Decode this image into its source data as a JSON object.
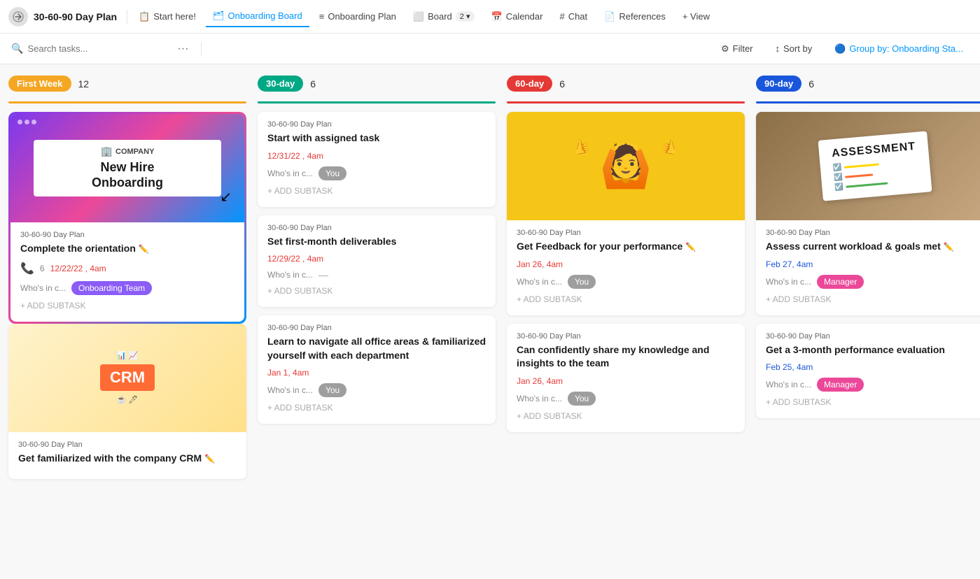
{
  "header": {
    "logo_text": "☰",
    "title": "30-60-90 Day Plan",
    "nav_items": [
      {
        "label": "Start here!",
        "icon": "📋",
        "active": false
      },
      {
        "label": "Onboarding Board",
        "icon": "🗂",
        "active": true
      },
      {
        "label": "Onboarding Plan",
        "icon": "≡",
        "active": false
      },
      {
        "label": "Board",
        "icon": "⬜",
        "active": false,
        "badge": "2"
      },
      {
        "label": "Calendar",
        "icon": "📅",
        "active": false
      },
      {
        "label": "Chat",
        "icon": "#",
        "active": false
      },
      {
        "label": "References",
        "icon": "📄",
        "active": false
      },
      {
        "label": "+ View",
        "icon": "",
        "active": false
      }
    ]
  },
  "toolbar": {
    "search_placeholder": "Search tasks...",
    "filter_label": "Filter",
    "sort_label": "Sort by",
    "group_by_label": "Group by: Onboarding Sta..."
  },
  "columns": [
    {
      "id": "first-week",
      "tag": "First Week",
      "tag_class": "tag-first",
      "line_class": "line-first",
      "count": 12,
      "cards": [
        {
          "type": "onboarding-image",
          "project": "30-60-90 Day Plan",
          "title": "Complete the orientation",
          "has_edit": true,
          "date": "12/22/22 , 4am",
          "date_class": "card-date-red",
          "subtask_count": "6",
          "who": "Onboarding Team",
          "who_badge": "badge-team",
          "add_subtask": "+ ADD SUBTASK"
        },
        {
          "type": "crm-image",
          "project": "30-60-90 Day Plan",
          "title": "Get familiarized with the company CRM",
          "has_edit": true
        }
      ]
    },
    {
      "id": "30-day",
      "tag": "30-day",
      "tag_class": "tag-30",
      "line_class": "line-30",
      "count": 6,
      "cards": [
        {
          "type": "no-image",
          "project": "30-60-90 Day Plan",
          "title": "Start with assigned task",
          "has_edit": false,
          "date": "12/31/22 , 4am",
          "date_class": "card-date-red",
          "who": "You",
          "who_badge": "badge-you",
          "add_subtask": "+ ADD SUBTASK"
        },
        {
          "type": "no-image",
          "project": "30-60-90 Day Plan",
          "title": "Set first-month deliverables",
          "has_edit": false,
          "date": "12/29/22 , 4am",
          "date_class": "card-date-red",
          "who": "—",
          "who_badge": "",
          "add_subtask": "+ ADD SUBTASK"
        },
        {
          "type": "no-image",
          "project": "30-60-90 Day Plan",
          "title": "Learn to navigate all office areas & familiarized yourself with each department",
          "has_edit": false,
          "date": "Jan 1, 4am",
          "date_class": "card-date-red",
          "who": "You",
          "who_badge": "badge-you",
          "add_subtask": "+ ADD SUBTASK"
        }
      ]
    },
    {
      "id": "60-day",
      "tag": "60-day",
      "tag_class": "tag-60",
      "line_class": "line-60",
      "count": 6,
      "cards": [
        {
          "type": "perf-image",
          "project": "30-60-90 Day Plan",
          "title": "Get Feedback for your performance",
          "has_edit": true,
          "date": "Jan 26, 4am",
          "date_class": "card-date-red",
          "who": "You",
          "who_badge": "badge-you",
          "add_subtask": "+ ADD SUBTASK"
        },
        {
          "type": "no-image",
          "project": "30-60-90 Day Plan",
          "title": "Can confidently share my knowledge and insights to the team",
          "has_edit": false,
          "date": "Jan 26, 4am",
          "date_class": "card-date-red",
          "who": "You",
          "who_badge": "badge-you",
          "add_subtask": "+ ADD SUBTASK"
        }
      ]
    },
    {
      "id": "90-day",
      "tag": "90-day",
      "tag_class": "tag-90",
      "line_class": "line-90",
      "count": 6,
      "cards": [
        {
          "type": "assess-image",
          "project": "30-60-90 Day Plan",
          "title": "Assess current workload & goals met",
          "has_edit": true,
          "date": "Feb 27, 4am",
          "date_class": "card-date-blue",
          "who": "Manager",
          "who_badge": "badge-manager",
          "add_subtask": "+ ADD SUBTASK"
        },
        {
          "type": "no-image",
          "project": "30-60-90 Day Plan",
          "title": "Get a 3-month performance evaluation",
          "has_edit": false,
          "date": "Feb 25, 4am",
          "date_class": "card-date-blue",
          "who": "Manager",
          "who_badge": "badge-manager",
          "add_subtask": "+ ADD SUBTASK"
        }
      ]
    }
  ],
  "labels": {
    "whos_in_charge": "Who's in c...",
    "add_subtask": "+ ADD SUBTASK",
    "filter": "Filter",
    "sort_by": "Sort by",
    "group_by": "Group by: Onboarding Sta...",
    "you_badge": "You",
    "onboarding_team_badge": "Onboarding Team",
    "manager_badge": "Manager",
    "dash": "—",
    "crm_title": "CRM",
    "assess_title": "ASSESSMENT",
    "new_hire_title": "New Hire\nOnboarding",
    "company_name": "COMPANY"
  }
}
